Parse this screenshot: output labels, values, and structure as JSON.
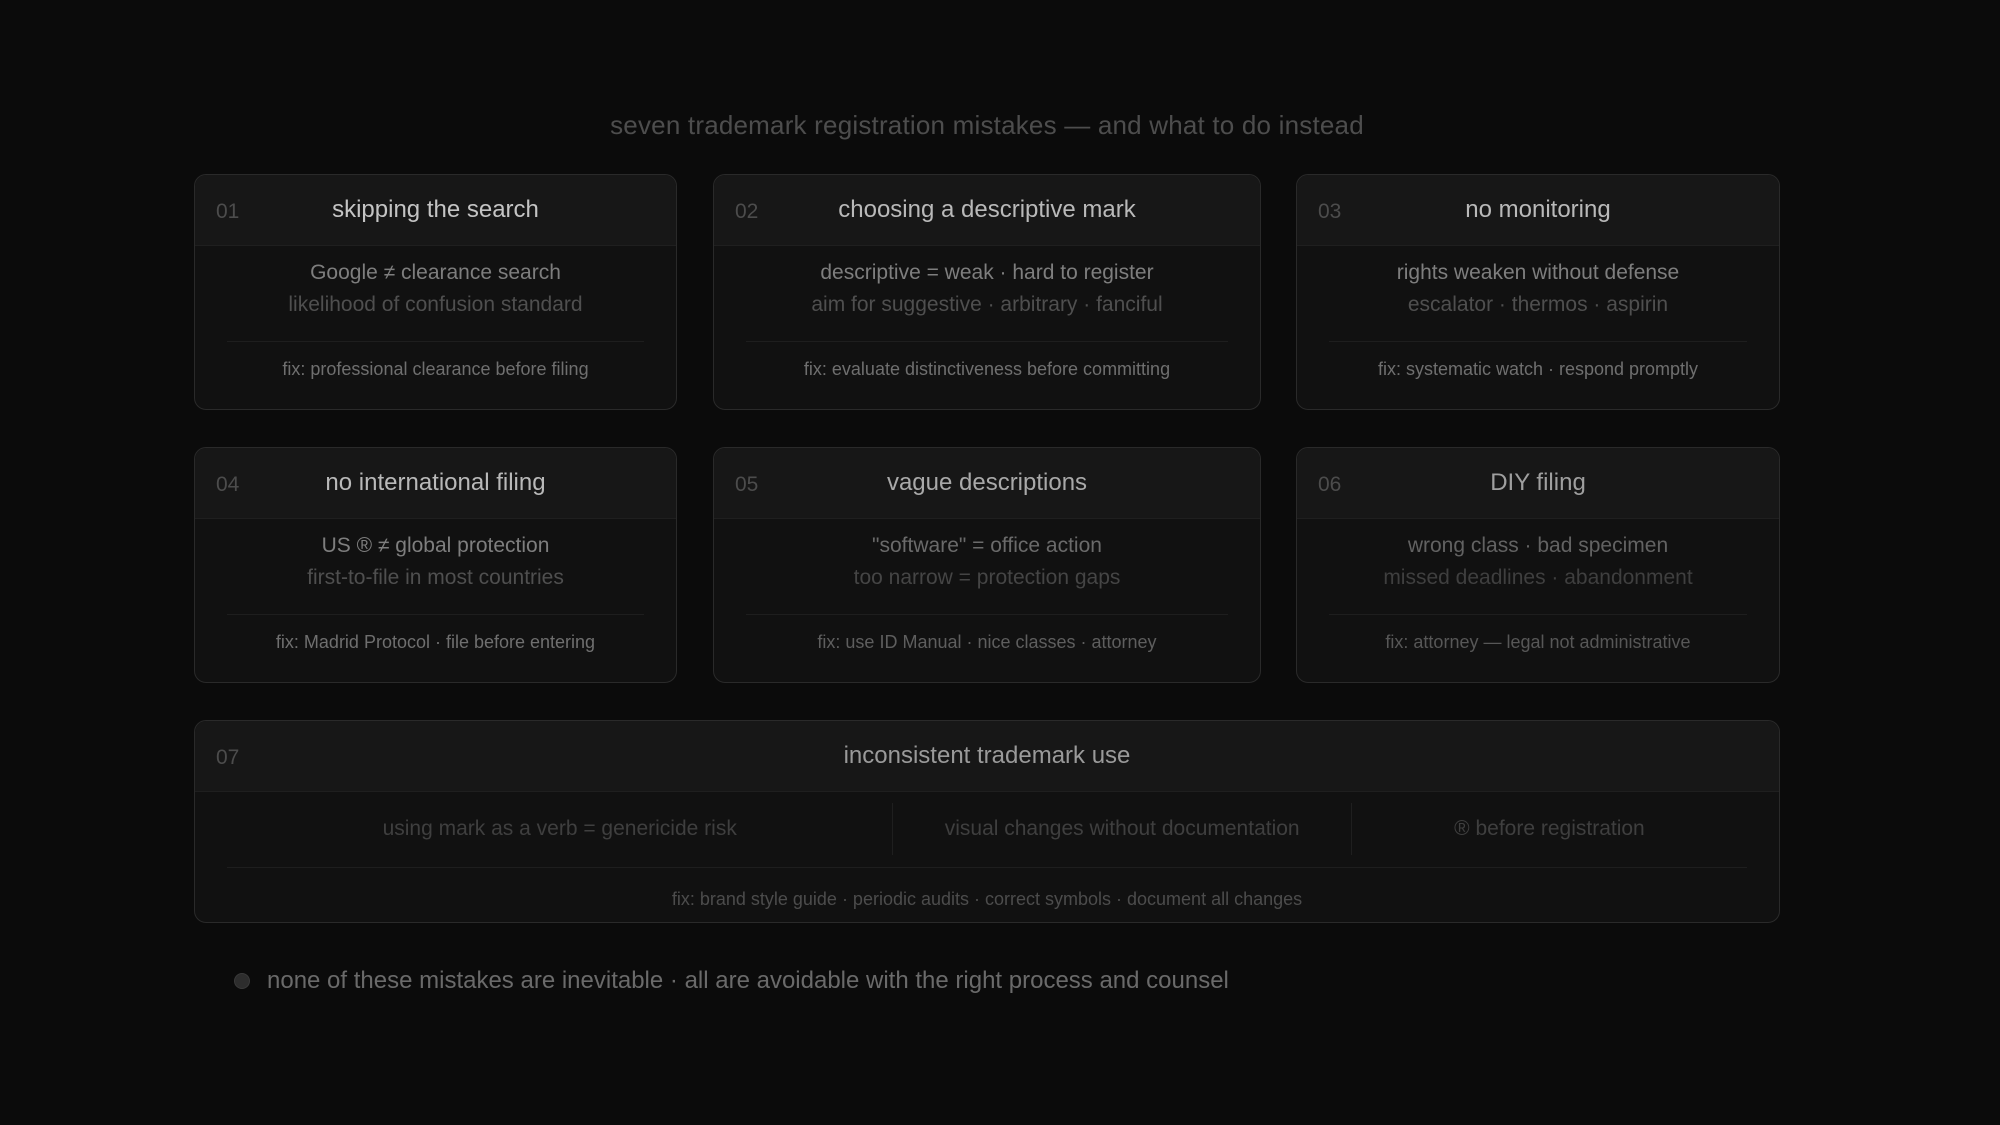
{
  "title": "seven trademark registration mistakes — and what to do instead",
  "cards": [
    {
      "num": "01",
      "title": "skipping the search",
      "line1": "Google ≠ clearance search",
      "line2": "likelihood of confusion standard",
      "fix": "fix: professional clearance before filing"
    },
    {
      "num": "02",
      "title": "choosing a descriptive mark",
      "line1": "descriptive = weak · hard to register",
      "line2": "aim for suggestive · arbitrary · fanciful",
      "fix": "fix: evaluate distinctiveness before committing"
    },
    {
      "num": "03",
      "title": "no monitoring",
      "line1": "rights weaken without defense",
      "line2": "escalator · thermos · aspirin",
      "fix": "fix: systematic watch · respond promptly"
    },
    {
      "num": "04",
      "title": "no international filing",
      "line1": "US ® ≠ global protection",
      "line2": "first-to-file in most countries",
      "fix": "fix: Madrid Protocol · file before entering"
    },
    {
      "num": "05",
      "title": "vague descriptions",
      "line1": "\"software\" = office action",
      "line2": "too narrow = protection gaps",
      "fix": "fix: use ID Manual · nice classes · attorney"
    },
    {
      "num": "06",
      "title": "DIY filing",
      "line1": "wrong class · bad specimen",
      "line2": "missed deadlines · abandonment",
      "fix": "fix: attorney — legal not administrative"
    }
  ],
  "wide_card": {
    "num": "07",
    "title": "inconsistent trademark use",
    "col1": "using mark as a verb = genericide risk",
    "col2": "visual changes without documentation",
    "col3": "® before registration",
    "fix": "fix: brand style guide · periodic audits · correct symbols · document all changes"
  },
  "footer": {
    "text": "none of these mistakes are inevitable · all are avoidable with the right process and counsel"
  }
}
